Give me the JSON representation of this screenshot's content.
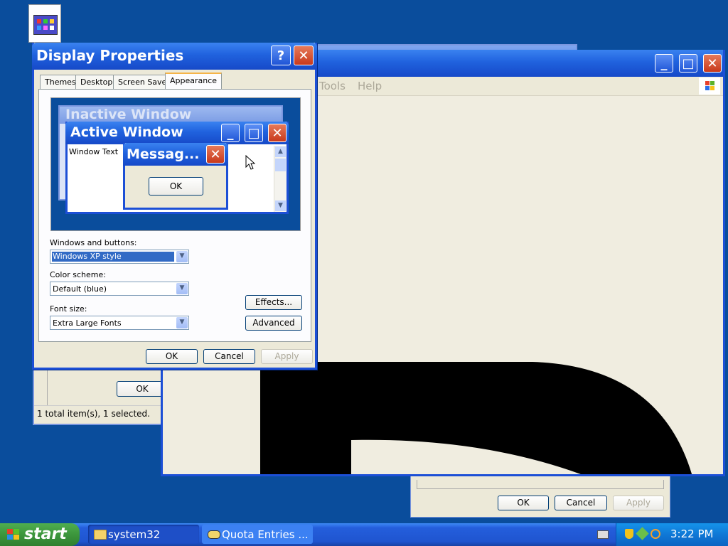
{
  "desktop": {
    "icon_name": "control-panel-applet-icon"
  },
  "bg_window": {
    "menu": [
      "Tools",
      "Help"
    ],
    "status": "1 total item(s), 1 selected.",
    "ok_label": "OK"
  },
  "bottom_dialog": {
    "ok": "OK",
    "cancel": "Cancel",
    "apply": "Apply"
  },
  "display_properties": {
    "title": "Display Properties",
    "tabs": [
      "Themes",
      "Desktop",
      "Screen Saver",
      "Appearance"
    ],
    "preview": {
      "inactive_title": "Inactive Window",
      "active_title": "Active Window",
      "window_text": "Window Text",
      "message_title": "Messag...",
      "message_ok": "OK"
    },
    "windows_buttons_label": "Windows and buttons:",
    "windows_buttons_value": "Windows XP style",
    "color_scheme_label": "Color scheme:",
    "color_scheme_value": "Default (blue)",
    "font_size_label": "Font size:",
    "font_size_value": "Extra Large Fonts",
    "effects_label": "Effects...",
    "advanced_label": "Advanced",
    "ok": "OK",
    "cancel": "Cancel",
    "apply": "Apply"
  },
  "taskbar": {
    "start_label": "start",
    "items": [
      {
        "label": "system32",
        "icon": "folder-icon"
      },
      {
        "label": "Quota Entries ...",
        "icon": "drive-icon"
      }
    ],
    "clock": "3:22 PM"
  }
}
